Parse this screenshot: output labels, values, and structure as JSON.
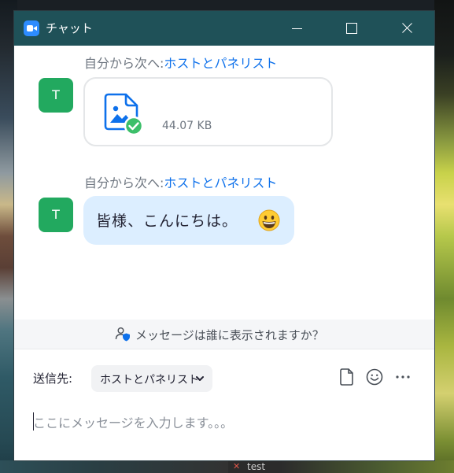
{
  "window": {
    "title": "チャット",
    "app_icon": "video-camera-icon",
    "controls": [
      "minimize-icon",
      "maximize-icon",
      "close-icon"
    ]
  },
  "messages": [
    {
      "avatar_initial": "T",
      "sender_prefix": "自分から次へ:",
      "recipient": "ホストとパネリスト",
      "type": "file",
      "file_icon": "image-file-icon",
      "status_icon": "check-circle-icon",
      "file_size": "44.07 KB"
    },
    {
      "avatar_initial": "T",
      "sender_prefix": "自分から次へ:",
      "recipient": "ホストとパネリスト",
      "type": "text",
      "text": "皆様、こんにちは。",
      "emoji": "grinning-face-emoji"
    }
  ],
  "visibility": {
    "icon": "user-shield-icon",
    "text": "メッセージは誰に表示されますか？"
  },
  "compose": {
    "to_label": "送信先:",
    "to_value": "ホストとパネリスト",
    "tools": [
      "file-icon",
      "emoji-icon",
      "more-icon"
    ],
    "placeholder": "ここにメッセージを入力します。。。"
  },
  "taskbar": {
    "item_label": "test"
  },
  "colors": {
    "titlebar": "#1f5158",
    "accent": "#0e71eb",
    "avatar": "#22a95f",
    "bubble": "#dceeff",
    "success": "#3cbf6a"
  }
}
